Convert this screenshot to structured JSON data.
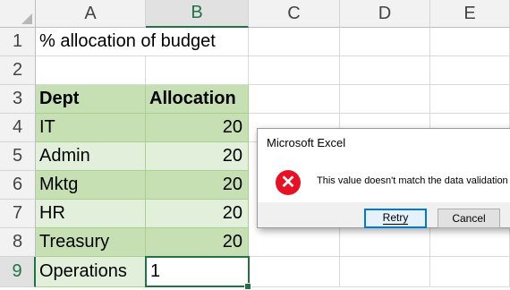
{
  "columns": [
    "A",
    "B",
    "C",
    "D",
    "E"
  ],
  "rows": [
    "1",
    "2",
    "3",
    "4",
    "5",
    "6",
    "7",
    "8",
    "9"
  ],
  "sheet": {
    "title": "% allocation of budget",
    "table_headers": [
      "Dept",
      "Allocation"
    ],
    "table_rows": [
      {
        "dept": "IT",
        "allocation": "20"
      },
      {
        "dept": "Admin",
        "allocation": "20"
      },
      {
        "dept": "Mktg",
        "allocation": "20"
      },
      {
        "dept": "HR",
        "allocation": "20"
      },
      {
        "dept": "Treasury",
        "allocation": "20"
      }
    ],
    "entry_row": {
      "dept": "Operations",
      "allocation": "1"
    }
  },
  "dialog": {
    "title": "Microsoft Excel",
    "message": "This value doesn't match the data validation",
    "icon": "error-icon",
    "buttons": {
      "retry": "Retry",
      "cancel": "Cancel"
    }
  },
  "colors": {
    "accent": "#217346",
    "band_dark": "#c6e0b4",
    "band_light": "#e2efda",
    "error": "#e81123"
  }
}
